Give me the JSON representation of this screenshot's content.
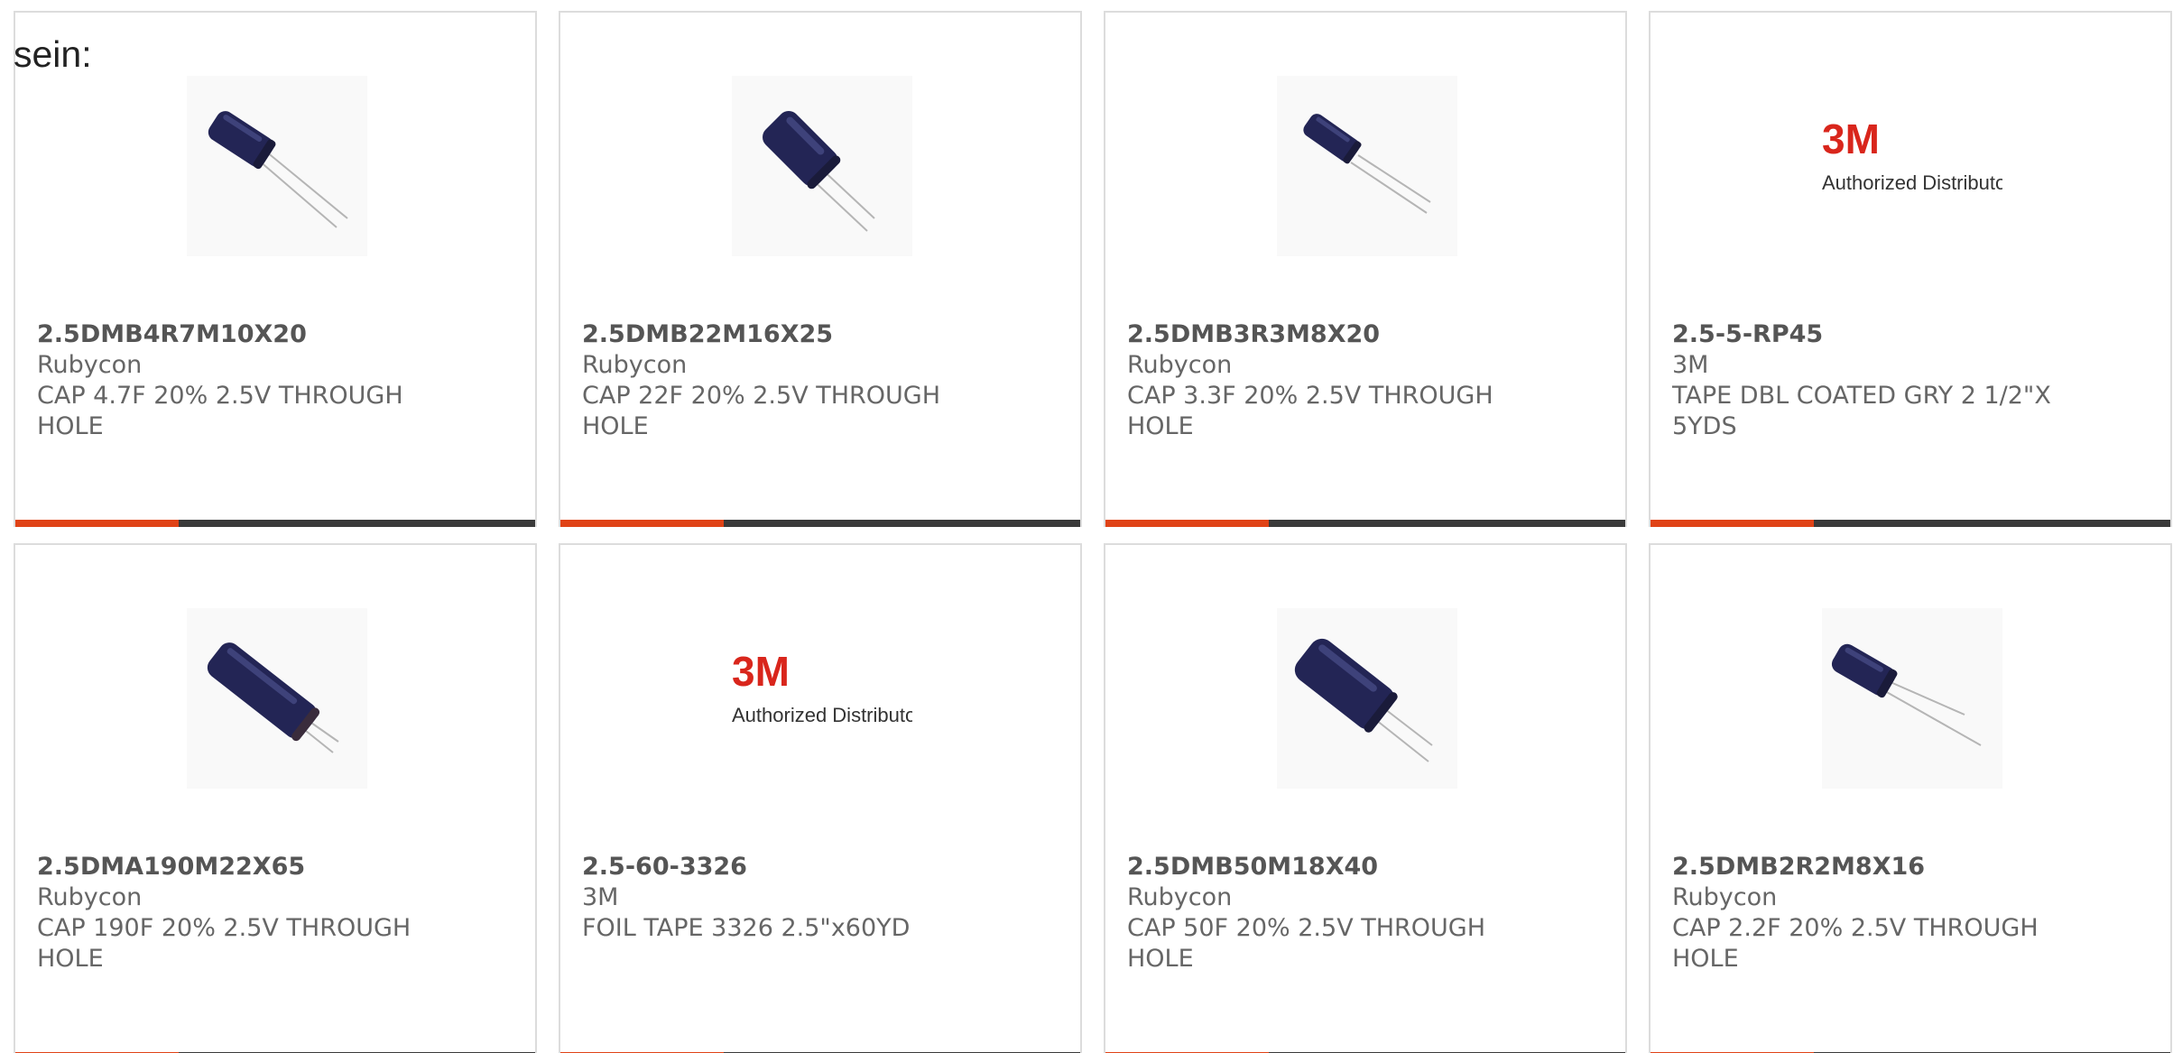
{
  "intro_text": "sein:",
  "colors": {
    "accent_bar": "#e04317",
    "dark_bar": "#3a3a3a",
    "logo_red": "#d9261c",
    "capacitor_body": "#232555"
  },
  "bar_accent_fraction": 0.315,
  "products": [
    {
      "part": "2.5DMB4R7M10X20",
      "manufacturer": "Rubycon",
      "description": "CAP 4.7F 20% 2.5V THROUGH HOLE",
      "image": "capacitor-image"
    },
    {
      "part": "2.5DMB22M16X25",
      "manufacturer": "Rubycon",
      "description": "CAP 22F 20% 2.5V THROUGH HOLE",
      "image": "capacitor-image"
    },
    {
      "part": "2.5DMB3R3M8X20",
      "manufacturer": "Rubycon",
      "description": "CAP 3.3F 20% 2.5V THROUGH HOLE",
      "image": "capacitor-image"
    },
    {
      "part": "2.5-5-RP45",
      "manufacturer": "3M",
      "description": "TAPE DBL COATED GRY 2 1/2\"X 5YDS",
      "image": "3m-logo",
      "logo_text": "3M",
      "logo_subtext": "Authorized Distributor"
    },
    {
      "part": "2.5DMA190M22X65",
      "manufacturer": "Rubycon",
      "description": "CAP 190F 20% 2.5V THROUGH HOLE",
      "image": "capacitor-image"
    },
    {
      "part": "2.5-60-3326",
      "manufacturer": "3M",
      "description": "FOIL TAPE 3326 2.5\"x60YD",
      "image": "3m-logo",
      "logo_text": "3M",
      "logo_subtext": "Authorized Distributor"
    },
    {
      "part": "2.5DMB50M18X40",
      "manufacturer": "Rubycon",
      "description": "CAP 50F 20% 2.5V THROUGH HOLE",
      "image": "capacitor-image"
    },
    {
      "part": "2.5DMB2R2M8X16",
      "manufacturer": "Rubycon",
      "description": "CAP 2.2F 20% 2.5V THROUGH HOLE",
      "image": "capacitor-image"
    }
  ]
}
